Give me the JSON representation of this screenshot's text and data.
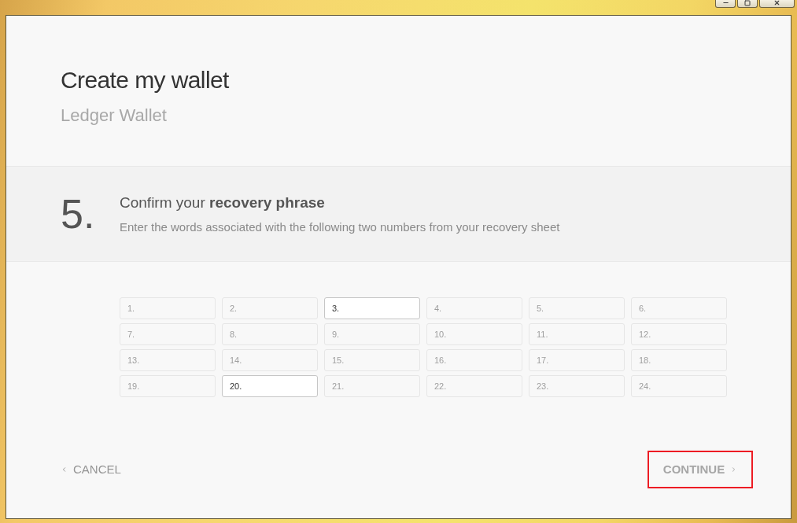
{
  "window_controls": [
    {
      "kind": "minimize"
    },
    {
      "kind": "maximize"
    },
    {
      "kind": "close"
    }
  ],
  "header": {
    "title": "Create my wallet",
    "subtitle": "Ledger Wallet"
  },
  "step": {
    "number": "5.",
    "title": "Confirm your **recovery phrase**",
    "description": "Enter the words associated with the following two numbers from your recovery sheet"
  },
  "word_fields": [
    {
      "label": "1.",
      "enabled": false
    },
    {
      "label": "2.",
      "enabled": false
    },
    {
      "label": "3.",
      "enabled": true
    },
    {
      "label": "4.",
      "enabled": false
    },
    {
      "label": "5.",
      "enabled": false
    },
    {
      "label": "6.",
      "enabled": false
    },
    {
      "label": "7.",
      "enabled": false
    },
    {
      "label": "8.",
      "enabled": false
    },
    {
      "label": "9.",
      "enabled": false
    },
    {
      "label": "10.",
      "enabled": false
    },
    {
      "label": "11.",
      "enabled": false
    },
    {
      "label": "12.",
      "enabled": false
    },
    {
      "label": "13.",
      "enabled": false
    },
    {
      "label": "14.",
      "enabled": false
    },
    {
      "label": "15.",
      "enabled": false
    },
    {
      "label": "16.",
      "enabled": false
    },
    {
      "label": "17.",
      "enabled": false
    },
    {
      "label": "18.",
      "enabled": false
    },
    {
      "label": "19.",
      "enabled": false
    },
    {
      "label": "20.",
      "enabled": true
    },
    {
      "label": "21.",
      "enabled": false
    },
    {
      "label": "22.",
      "enabled": false
    },
    {
      "label": "23.",
      "enabled": false
    },
    {
      "label": "24.",
      "enabled": false
    }
  ],
  "footer": {
    "cancel": {
      "label": "CANCEL"
    },
    "continue": {
      "label": "CONTINUE",
      "disabled": true,
      "highlighted": true
    }
  }
}
